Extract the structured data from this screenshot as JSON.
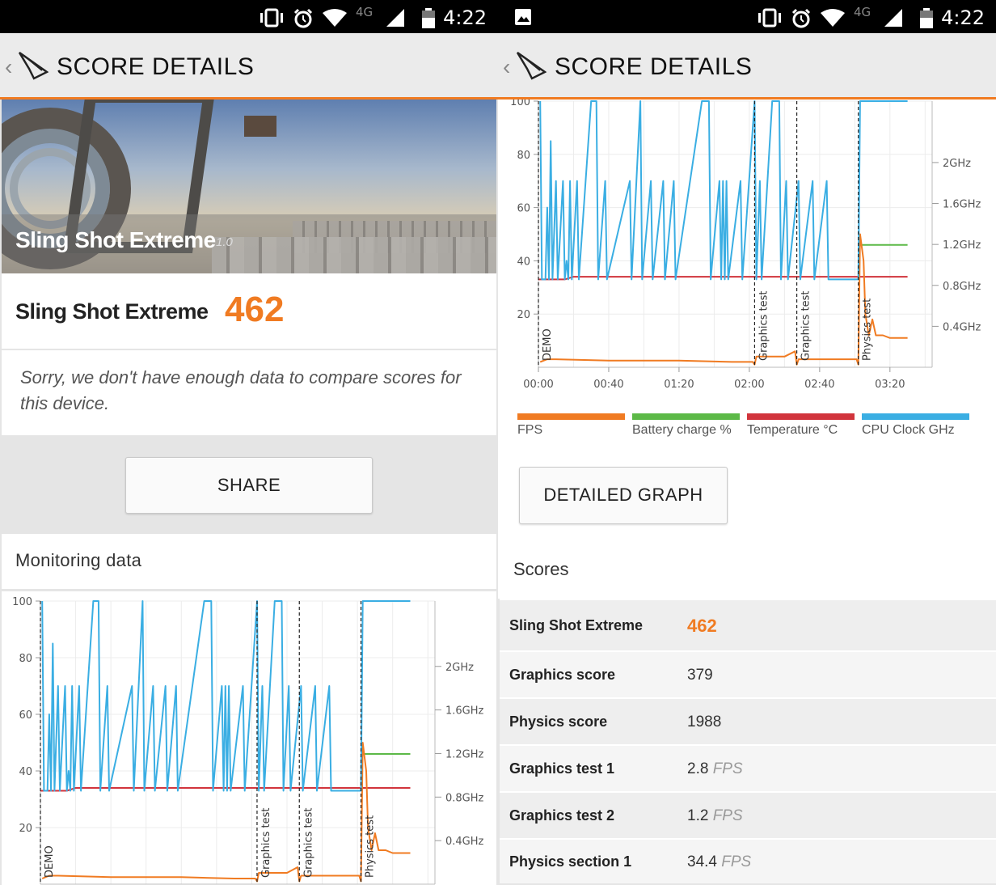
{
  "status_bar": {
    "time": "4:22",
    "network": "4G"
  },
  "app_bar": {
    "title": "SCORE DETAILS"
  },
  "banner": {
    "name": "Sling Shot Extreme",
    "version": "1.0"
  },
  "result": {
    "test_name": "Sling Shot Extreme",
    "score": "462",
    "no_compare_message": "Sorry, we don't have enough data to compare scores for this device."
  },
  "buttons": {
    "share": "SHARE",
    "detailed_graph": "DETAILED GRAPH"
  },
  "monitoring": {
    "title": "Monitoring data"
  },
  "legend": [
    {
      "label": "FPS",
      "color": "#f07b22"
    },
    {
      "label": "Battery charge %",
      "color": "#5cb947"
    },
    {
      "label": "Temperature °C",
      "color": "#d1343c"
    },
    {
      "label": "CPU Clock GHz",
      "color": "#3aaee3"
    }
  ],
  "scores": {
    "title": "Scores",
    "rows": [
      {
        "label": "Sling Shot Extreme",
        "value": "462",
        "unit": ""
      },
      {
        "label": "Graphics score",
        "value": "379",
        "unit": ""
      },
      {
        "label": "Physics score",
        "value": "1988",
        "unit": ""
      },
      {
        "label": "Graphics test 1",
        "value": "2.8",
        "unit": "FPS"
      },
      {
        "label": "Graphics test 2",
        "value": "1.2",
        "unit": "FPS"
      },
      {
        "label": "Physics section 1",
        "value": "34.4",
        "unit": "FPS"
      }
    ]
  },
  "chart_data": {
    "type": "line",
    "x_ticks": [
      "00:00",
      "00:40",
      "01:20",
      "02:00",
      "02:40",
      "03:20"
    ],
    "x_range_seconds": [
      0,
      224
    ],
    "y_ticks_left": [
      20,
      40,
      60,
      80,
      100
    ],
    "y_range_left": [
      0,
      100
    ],
    "y_ticks_right": [
      "0.4GHz",
      "0.8GHz",
      "1.2GHz",
      "1.6GHz",
      "2GHz"
    ],
    "y_range_right_ghz": [
      0,
      2.6
    ],
    "phase_markers": [
      {
        "label": "DEMO",
        "t": 0
      },
      {
        "label": "Graphics test",
        "t": 123
      },
      {
        "label": "Graphics test",
        "t": 147
      },
      {
        "label": "Physics test",
        "t": 182
      }
    ],
    "series": [
      {
        "name": "Battery charge %",
        "color": "#5cb947",
        "points": [
          [
            182,
            46
          ],
          [
            210,
            46
          ]
        ]
      },
      {
        "name": "Temperature °C",
        "color": "#d1343c",
        "points": [
          [
            0,
            33
          ],
          [
            15,
            33
          ],
          [
            20,
            34
          ],
          [
            60,
            34
          ],
          [
            140,
            34
          ],
          [
            182,
            34
          ],
          [
            210,
            34
          ]
        ]
      },
      {
        "name": "FPS",
        "color": "#f07b22",
        "points": [
          [
            1,
            2
          ],
          [
            5,
            3
          ],
          [
            10,
            3
          ],
          [
            40,
            2.5
          ],
          [
            80,
            2.5
          ],
          [
            110,
            2
          ],
          [
            122,
            2
          ],
          [
            123,
            1
          ],
          [
            124,
            4
          ],
          [
            130,
            4
          ],
          [
            140,
            4
          ],
          [
            146,
            6
          ],
          [
            147,
            1
          ],
          [
            148,
            3
          ],
          [
            160,
            3
          ],
          [
            170,
            3
          ],
          [
            181,
            3
          ],
          [
            182,
            1
          ],
          [
            183,
            50
          ],
          [
            185,
            40
          ],
          [
            186,
            20
          ],
          [
            188,
            12
          ],
          [
            190,
            18
          ],
          [
            192,
            12
          ],
          [
            196,
            12
          ],
          [
            200,
            11
          ],
          [
            210,
            11
          ]
        ]
      },
      {
        "name": "CPU Clock GHz",
        "color": "#3aaee3",
        "points": [
          [
            1,
            100
          ],
          [
            2,
            33
          ],
          [
            4,
            33
          ],
          [
            5,
            60
          ],
          [
            6,
            33
          ],
          [
            7,
            85
          ],
          [
            8,
            33
          ],
          [
            10,
            70
          ],
          [
            11,
            33
          ],
          [
            14,
            70
          ],
          [
            15,
            33
          ],
          [
            16,
            40
          ],
          [
            17,
            33
          ],
          [
            18,
            70
          ],
          [
            19,
            33
          ],
          [
            22,
            70
          ],
          [
            23,
            33
          ],
          [
            30,
            100
          ],
          [
            33,
            100
          ],
          [
            34,
            33
          ],
          [
            38,
            70
          ],
          [
            39,
            33
          ],
          [
            52,
            70
          ],
          [
            53,
            33
          ],
          [
            58,
            100
          ],
          [
            59,
            33
          ],
          [
            64,
            70
          ],
          [
            65,
            33
          ],
          [
            71,
            70
          ],
          [
            72,
            33
          ],
          [
            77,
            70
          ],
          [
            78,
            33
          ],
          [
            93,
            100
          ],
          [
            97,
            100
          ],
          [
            98,
            33
          ],
          [
            103,
            70
          ],
          [
            104,
            33
          ],
          [
            105,
            70
          ],
          [
            106,
            33
          ],
          [
            107,
            70
          ],
          [
            108,
            33
          ],
          [
            115,
            70
          ],
          [
            116,
            33
          ],
          [
            123,
            100
          ],
          [
            124,
            33
          ],
          [
            126,
            70
          ],
          [
            127,
            33
          ],
          [
            133,
            100
          ],
          [
            137,
            100
          ],
          [
            138,
            33
          ],
          [
            141,
            70
          ],
          [
            142,
            33
          ],
          [
            148,
            70
          ],
          [
            149,
            33
          ],
          [
            156,
            70
          ],
          [
            157,
            33
          ],
          [
            164,
            70
          ],
          [
            165,
            33
          ],
          [
            182,
            33
          ],
          [
            183,
            100
          ],
          [
            210,
            100
          ]
        ]
      }
    ]
  }
}
